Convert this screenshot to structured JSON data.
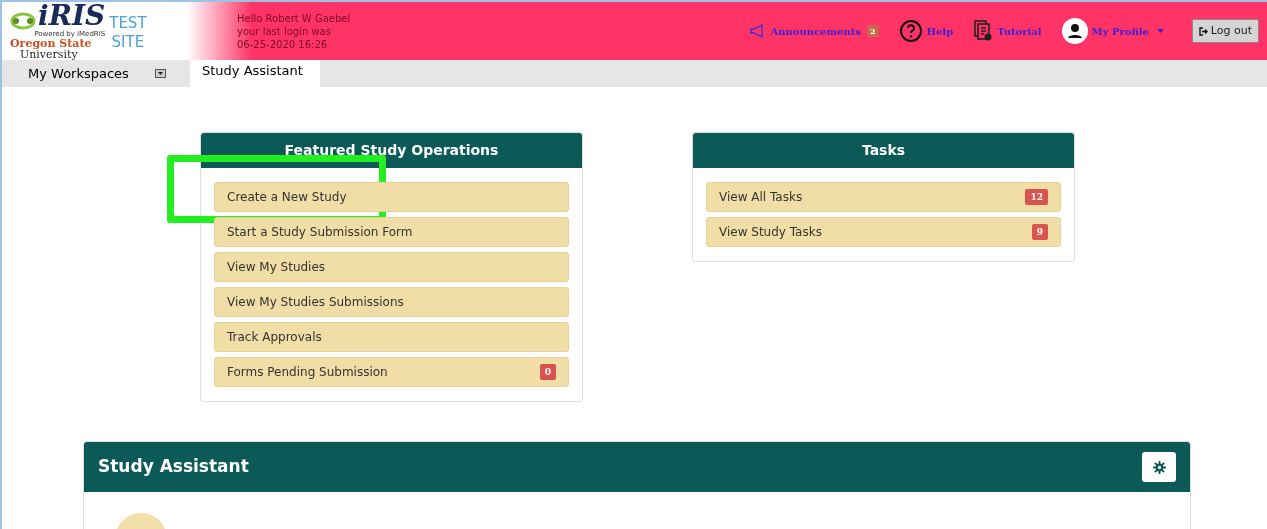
{
  "header": {
    "logo": {
      "name": "iRIS",
      "powered_by": "Powered by iMedRIS",
      "university": [
        "Oregon State",
        "University"
      ],
      "site_tag": [
        "TEST",
        "SITE"
      ]
    },
    "greeting": [
      "Hello Robert W Gaebel",
      "your last login was",
      "06-25-2020 16:26"
    ],
    "nav": [
      {
        "kind": "announcements",
        "label": "Announcements",
        "badge": "2"
      },
      {
        "kind": "help",
        "label": "Help"
      },
      {
        "kind": "tutorial",
        "label": "Tutorial"
      },
      {
        "kind": "profile",
        "label": "My Profile"
      }
    ],
    "logout": "Log out"
  },
  "tabs": [
    {
      "label": "My Workspaces",
      "kind": "menu",
      "selected": false
    },
    {
      "label": "Study Assistant",
      "kind": "tab",
      "selected": true
    }
  ],
  "panels": [
    {
      "title": "Featured Study Operations",
      "items": [
        {
          "label": "Create a New Study",
          "highlighted": true
        },
        {
          "label": "Start a Study Submission Form",
          "highlighted": false
        },
        {
          "label": "View My Studies",
          "highlighted": false
        },
        {
          "label": "View My Studies Submissions",
          "highlighted": false
        },
        {
          "label": "Track Approvals",
          "highlighted": false
        },
        {
          "label": "Forms Pending Submission",
          "badge": "0",
          "highlighted": false
        }
      ]
    },
    {
      "title": "Tasks",
      "items": [
        {
          "label": "View All Tasks",
          "badge": "12",
          "highlighted": false
        },
        {
          "label": "View Study Tasks",
          "badge": "9",
          "highlighted": false
        }
      ]
    }
  ],
  "assistant": {
    "title": "Study Assistant"
  }
}
